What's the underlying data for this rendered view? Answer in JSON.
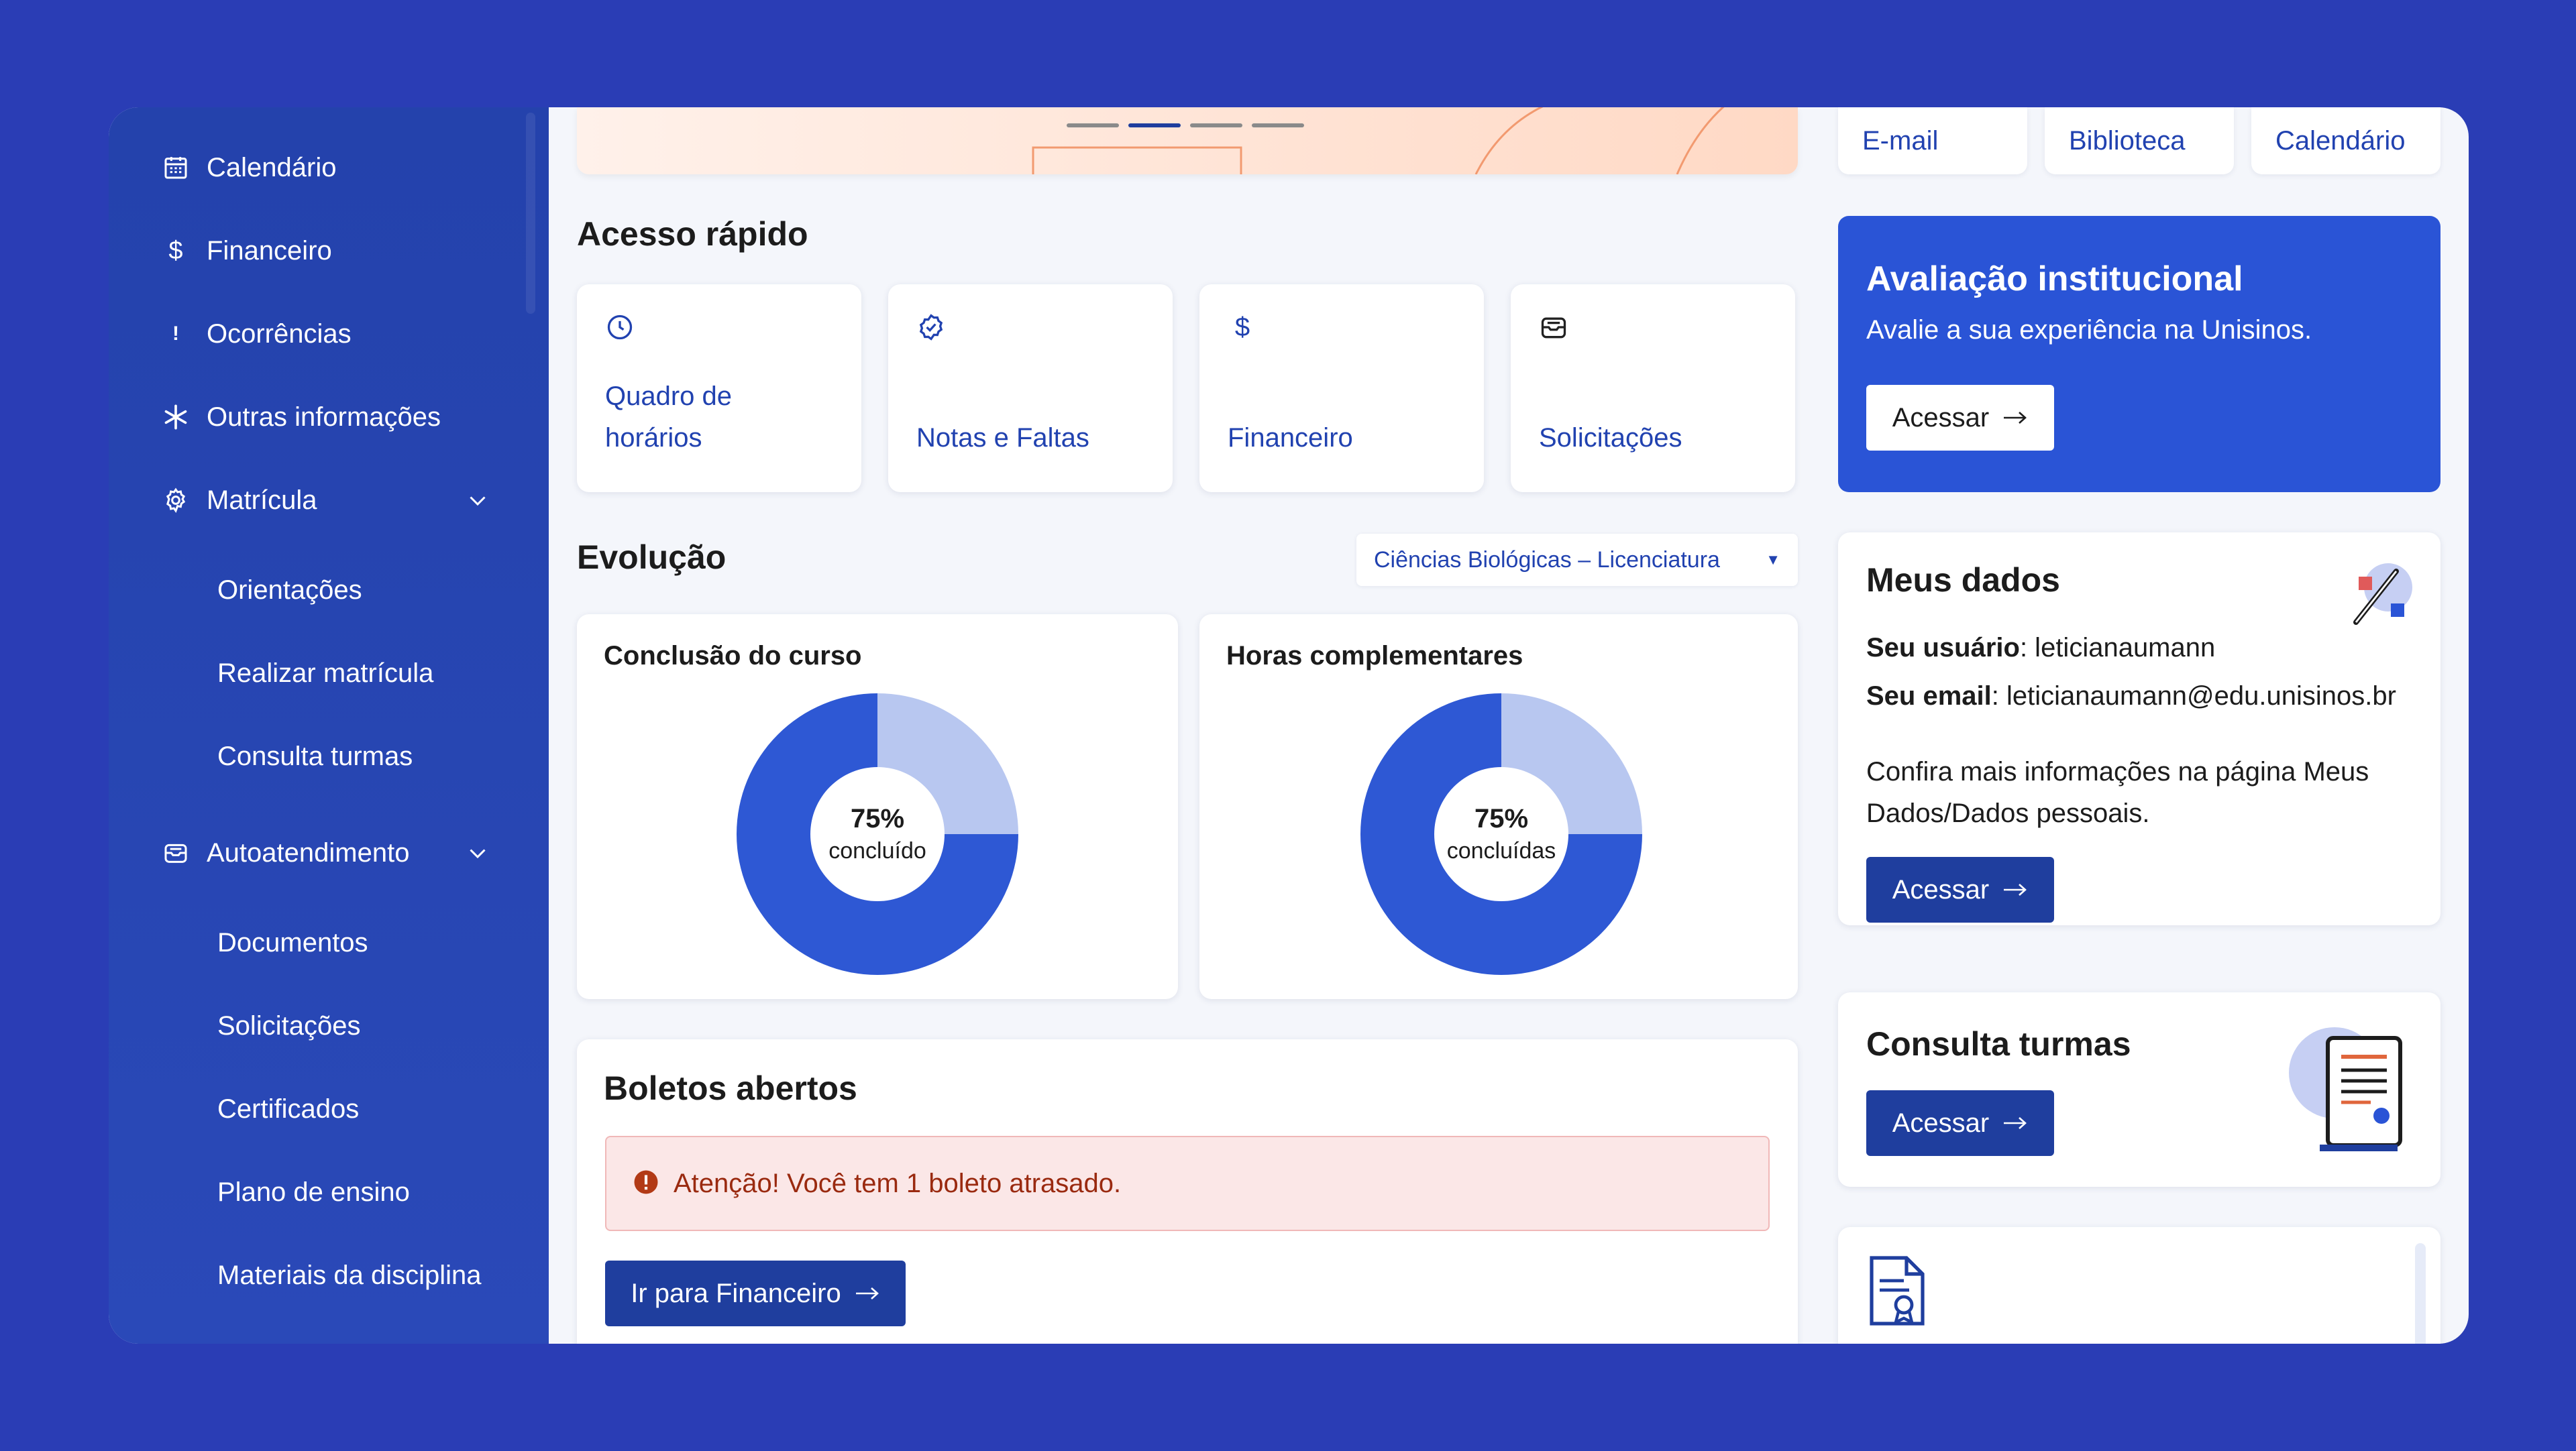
{
  "sidebar": {
    "items": [
      {
        "label": "Calendário",
        "icon": "calendar-icon"
      },
      {
        "label": "Financeiro",
        "icon": "dollar-icon"
      },
      {
        "label": "Ocorrências",
        "icon": "exclamation-icon"
      },
      {
        "label": "Outras informações",
        "icon": "asterisk-icon"
      },
      {
        "label": "Matrícula",
        "icon": "gear-icon"
      }
    ],
    "matricula_sub": [
      "Orientações",
      "Realizar matrícula",
      "Consulta turmas"
    ],
    "autoatendimento": {
      "label": "Autoatendimento",
      "icon": "inbox-icon"
    },
    "autoatendimento_sub": [
      "Documentos",
      "Solicitações",
      "Certificados",
      "Plano de ensino",
      "Materiais da disciplina"
    ]
  },
  "top_links": [
    "E-mail",
    "Biblioteca",
    "Calendário"
  ],
  "quick_access": {
    "title": "Acesso rápido",
    "items": [
      {
        "label_line1": "Quadro de",
        "label_line2": "horários",
        "icon": "clock-icon"
      },
      {
        "label": "Notas e Faltas",
        "icon": "check-badge-icon"
      },
      {
        "label": "Financeiro",
        "icon": "dollar-icon"
      },
      {
        "label": "Solicitações",
        "icon": "inbox-icon"
      }
    ]
  },
  "evolucao": {
    "title": "Evolução",
    "course": "Ciências Biológicas – Licenciatura",
    "charts": [
      {
        "title": "Conclusão do curso",
        "percent_label": "75%",
        "caption": "concluído"
      },
      {
        "title": "Horas complementares",
        "percent_label": "75%",
        "caption": "concluídas"
      }
    ]
  },
  "chart_data": [
    {
      "type": "pie",
      "title": "Conclusão do curso",
      "categories": [
        "concluído",
        "restante"
      ],
      "values": [
        75,
        25
      ],
      "colors": [
        "#2e58d4",
        "#b8c7f0"
      ]
    },
    {
      "type": "pie",
      "title": "Horas complementares",
      "categories": [
        "concluídas",
        "restante"
      ],
      "values": [
        75,
        25
      ],
      "colors": [
        "#2e58d4",
        "#b8c7f0"
      ]
    }
  ],
  "boletos": {
    "title": "Boletos abertos",
    "alert": "Atenção! Você tem 1 boleto atrasado.",
    "button": "Ir para Financeiro"
  },
  "avaliacao": {
    "title": "Avaliação institucional",
    "subtitle": "Avalie a sua experiência na Unisinos.",
    "button": "Acessar"
  },
  "meus_dados": {
    "title": "Meus dados",
    "user_label": "Seu usuário",
    "user_value": ": leticianaumann",
    "email_label": "Seu email",
    "email_value": ": leticianaumann@edu.unisinos.br",
    "info": "Confira mais informações na página Meus Dados/Dados pessoais.",
    "button": "Acessar"
  },
  "consulta_turmas": {
    "title": "Consulta turmas",
    "button": "Acessar"
  },
  "colors": {
    "background": "#2a3db5",
    "sidebar": "#2442ac",
    "accent": "#2a54d6",
    "button": "#1f3e9e",
    "link": "#2142b0"
  }
}
